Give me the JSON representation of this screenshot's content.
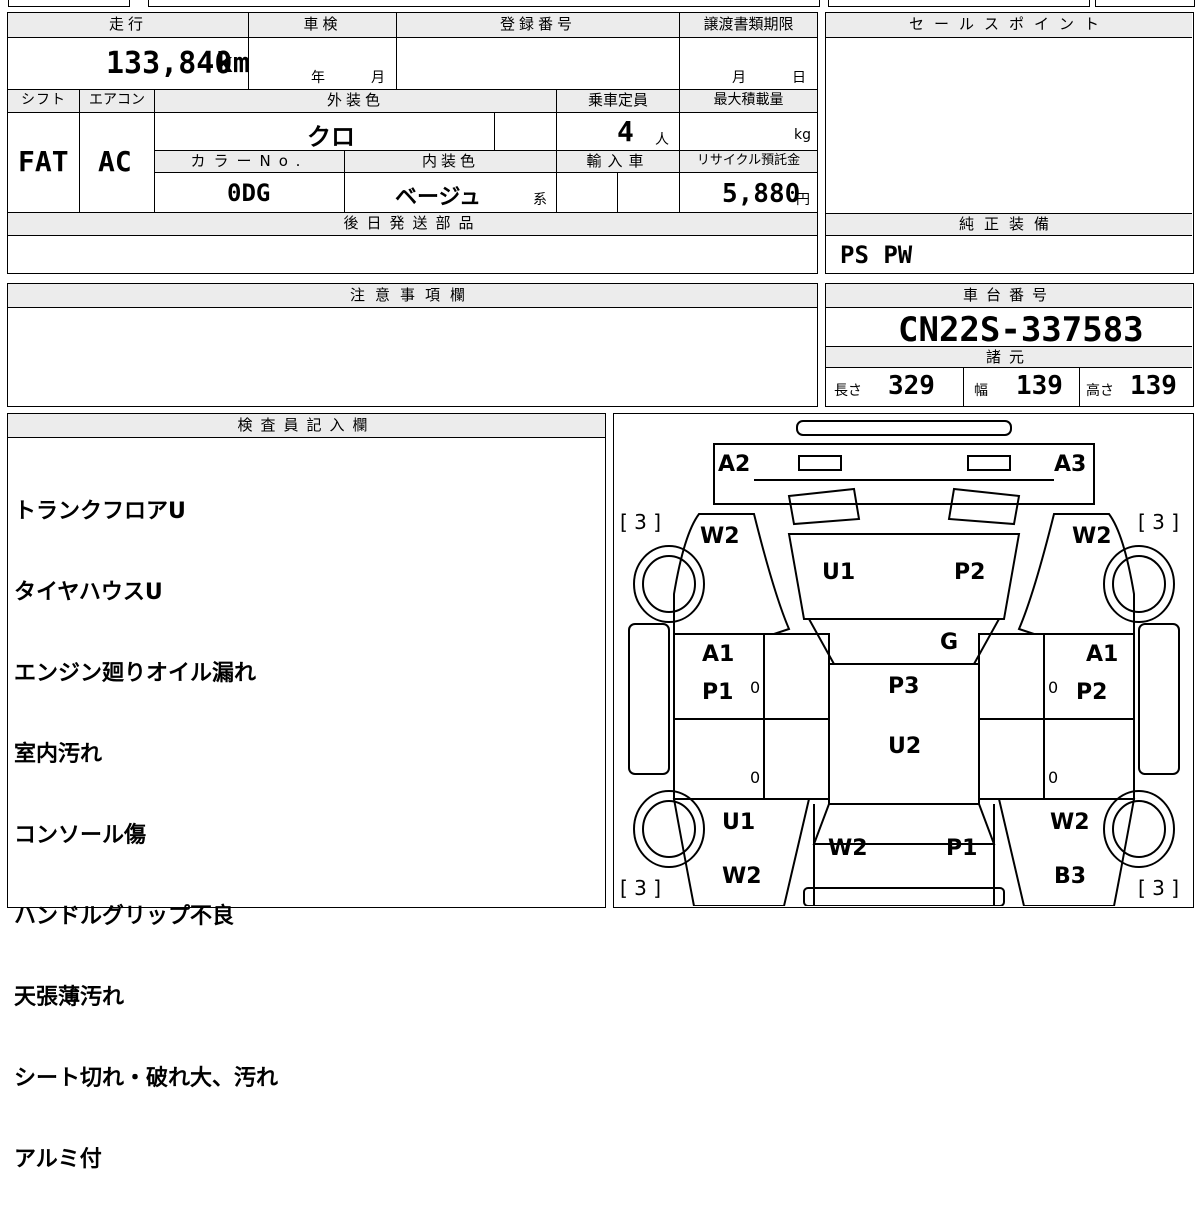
{
  "top": {
    "mileage_h": "走行",
    "mileage": "133,840",
    "mileage_unit": "km",
    "shaken_h": "車検",
    "year_unit": "年",
    "month_unit": "月",
    "reg_h": "登録番号",
    "transfer_h": "譲渡書類期限",
    "t_month": "月",
    "t_day": "日"
  },
  "row2": {
    "shift_h": "シフト",
    "shift": "FAT",
    "ac_h": "エアコン",
    "ac": "AC",
    "color_h": "外装色",
    "color": "クロ",
    "capacity_h": "乗車定員",
    "capacity": "4",
    "capacity_unit": "人",
    "load_h": "最大積載量",
    "load_unit": "kg",
    "colorno_h": "カラーNo.",
    "colorno": "0DG",
    "interior_h": "内装色",
    "interior": "ベージュ",
    "interior_suffix": "系",
    "import_h": "輸入車",
    "recycle_h": "リサイクル預託金",
    "recycle": "5,880",
    "recycle_unit": "円",
    "later_h": "後日発送部品"
  },
  "right": {
    "sales_h": "セールスポイント",
    "equip_h": "純正装備",
    "equip": "PS PW",
    "chassis_h": "車台番号",
    "chassis": "CN22S-337583",
    "spec_h": "諸元",
    "len_l": "長さ",
    "len": "329",
    "wid_l": "幅",
    "wid": "139",
    "hei_l": "高さ",
    "hei": "139"
  },
  "notes_h": "注意事項欄",
  "inspector": {
    "header": "検査員記入欄",
    "lines": [
      "トランクフロアU",
      "タイヤハウスU",
      "エンジン廻りオイル漏れ",
      "室内汚れ",
      "コンソール傷",
      "ハンドルグリップ不良",
      "天張薄汚れ",
      "シート切れ・破れ大、汚れ",
      "アルミ付"
    ]
  },
  "diagram": {
    "A2": "A2",
    "A3": "A3",
    "tire_l": "[ 3 ]",
    "tire_r": "[ 3 ]",
    "tire_bl": "[ 3 ]",
    "tire_br": "[ 3 ]",
    "W2_fl": "W2",
    "W2_fr": "W2",
    "U1_hood": "U1",
    "P2_hood": "P2",
    "G": "G",
    "A1_l": "A1",
    "P1_l": "P1",
    "A1_r": "A1",
    "P2_r": "P2",
    "P3": "P3",
    "U2": "U2",
    "z1": "0",
    "z2": "0",
    "z3": "0",
    "z4": "0",
    "U1_rl": "U1",
    "W2_rl": "W2",
    "W2_rr": "W2",
    "B3_rr": "B3",
    "W2_trunk": "W2",
    "P1_trunk": "P1"
  }
}
